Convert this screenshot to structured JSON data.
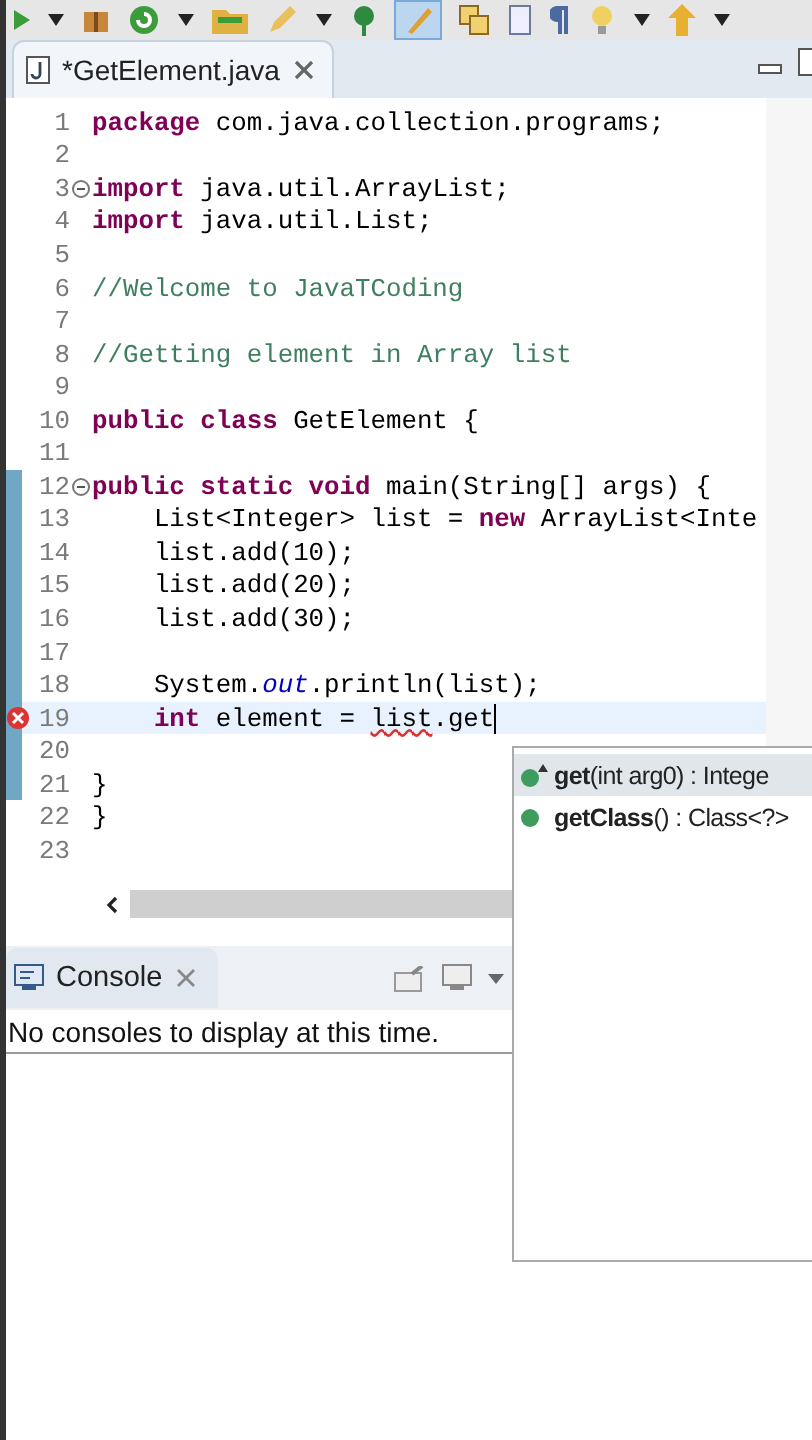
{
  "editor_tab": {
    "title": "*GetElement.java",
    "selected": true
  },
  "code_lines": [
    {
      "number": "1",
      "segments": [
        {
          "kind": "keyword",
          "text": "package"
        },
        {
          "kind": "plain",
          "text": " com.java.collection.programs;"
        }
      ]
    },
    {
      "number": "2"
    },
    {
      "number": "3",
      "folded": false,
      "segments": [
        {
          "kind": "keyword",
          "text": "import"
        },
        {
          "kind": "plain",
          "text": " java.util.ArrayList;"
        }
      ]
    },
    {
      "number": "4",
      "segments": [
        {
          "kind": "keyword",
          "text": "import"
        },
        {
          "kind": "plain",
          "text": " java.util.List;"
        }
      ]
    },
    {
      "number": "5"
    },
    {
      "number": "6",
      "segments": [
        {
          "kind": "comment",
          "text": "//Welcome to JavaTCoding"
        }
      ]
    },
    {
      "number": "7"
    },
    {
      "number": "8",
      "segments": [
        {
          "kind": "comment",
          "text": "//Getting element in Array list"
        }
      ]
    },
    {
      "number": "9"
    },
    {
      "number": "10",
      "segments": [
        {
          "kind": "keyword",
          "text": "public class"
        },
        {
          "kind": "plain",
          "text": " GetElement {"
        }
      ]
    },
    {
      "number": "11"
    },
    {
      "number": "12",
      "folded": false,
      "changed": true,
      "segments": [
        {
          "kind": "keyword",
          "text": "public static void"
        },
        {
          "kind": "plain",
          "text": " main(String[] args) {"
        }
      ]
    },
    {
      "number": "13",
      "changed": true,
      "segments": [
        {
          "kind": "plain",
          "text": "    List<Integer> list = "
        },
        {
          "kind": "keyword",
          "text": "new"
        },
        {
          "kind": "plain",
          "text": " ArrayList<Inte"
        }
      ]
    },
    {
      "number": "14",
      "changed": true,
      "segments": [
        {
          "kind": "plain",
          "text": "    list.add(10);"
        }
      ]
    },
    {
      "number": "15",
      "changed": true,
      "segments": [
        {
          "kind": "plain",
          "text": "    list.add(20);"
        }
      ]
    },
    {
      "number": "16",
      "changed": true,
      "segments": [
        {
          "kind": "plain",
          "text": "    list.add(30);"
        }
      ]
    },
    {
      "number": "17",
      "changed": true
    },
    {
      "number": "18",
      "changed": true,
      "segments": [
        {
          "kind": "plain",
          "text": "    System."
        },
        {
          "kind": "field",
          "text": "out"
        },
        {
          "kind": "plain",
          "text": ".println(list);"
        }
      ]
    },
    {
      "number": "19",
      "changed": true,
      "error": true,
      "current": true,
      "segments": [
        {
          "kind": "keyword",
          "text": "    int"
        },
        {
          "kind": "plain",
          "text": " element = "
        },
        {
          "kind": "error",
          "text": "list"
        },
        {
          "kind": "plain",
          "text": ".get"
        }
      ]
    },
    {
      "number": "20",
      "changed": true
    },
    {
      "number": "21",
      "changed": true,
      "segments": [
        {
          "kind": "plain",
          "text": "}"
        }
      ]
    },
    {
      "number": "22",
      "segments": [
        {
          "kind": "plain",
          "text": "}"
        }
      ]
    },
    {
      "number": "23"
    }
  ],
  "console": {
    "title": "Console",
    "message": "No consoles to display at this time."
  },
  "completions": [
    {
      "name": "get",
      "signature": "(int arg0) : Intege",
      "kind": "method-default",
      "selected": true
    },
    {
      "name": "getClass",
      "signature": "() : Class<?>",
      "kind": "method",
      "selected": false
    }
  ]
}
